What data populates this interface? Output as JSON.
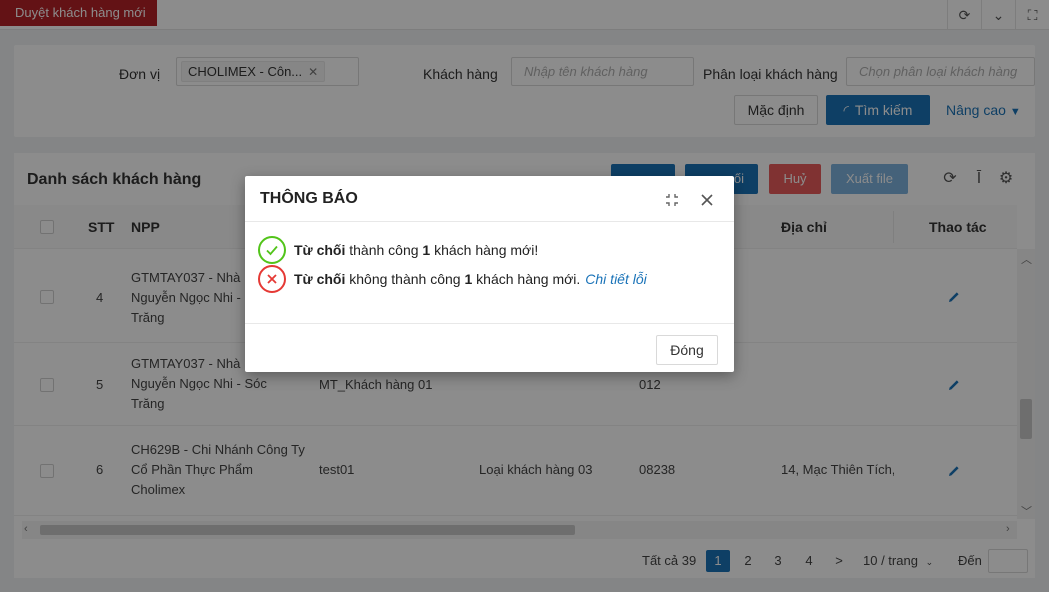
{
  "app": {
    "active_tab": "Duyệt khách hàng mới"
  },
  "filters": {
    "unit_label": "Đơn vị",
    "unit_tag": "CHOLIMEX - Côn...",
    "customer_label": "Khách hàng",
    "customer_placeholder": "Nhập tên khách hàng",
    "category_label": "Phân loại khách hàng",
    "category_placeholder": "Chọn phân loại khách hàng",
    "default_button": "Mặc định",
    "search_button": "Tìm kiếm",
    "advanced_button": "Nâng cao"
  },
  "list": {
    "title": "Danh sách khách hàng",
    "toolbar": {
      "reject_label": "...ối",
      "cancel_label": "Huỷ",
      "export_label": "Xuất file"
    },
    "columns": {
      "stt": "STT",
      "npp": "NPP",
      "address": "Địa chỉ",
      "actions": "Thao tác"
    },
    "rows": [
      {
        "stt": "4",
        "npp_lines": [
          "GTMTAY037 - Nhà",
          "Nguyễn Ngọc Nhi - Sóc",
          "Trăng"
        ],
        "name": "",
        "category": "",
        "code": "",
        "address": ""
      },
      {
        "stt": "5",
        "npp_lines": [
          "GTMTAY037 - Nhà",
          "Nguyễn Ngọc Nhi - Sóc",
          "Trăng"
        ],
        "name": "MT_Khách hàng 01",
        "category": "",
        "code": "012",
        "address": ""
      },
      {
        "stt": "6",
        "npp_lines": [
          "CH629B - Chi Nhánh Công Ty",
          "Cổ Phần Thực Phẩm",
          "Cholimex"
        ],
        "name": "test01",
        "category": "Loại khách hàng 03",
        "code": "08238",
        "address": "14, Mạc Thiên Tích,"
      }
    ]
  },
  "pagination": {
    "total": "Tất cả 39",
    "pages": [
      "1",
      "2",
      "3",
      "4"
    ],
    "active_page": "1",
    "next": ">",
    "page_size": "10 / trang",
    "goto_label": "Đến"
  },
  "modal": {
    "title": "THÔNG BÁO",
    "success": {
      "bold": "Từ chối",
      "text1": " thành công ",
      "count": "1",
      "text2": " khách hàng mới!"
    },
    "failure": {
      "bold": "Từ chối",
      "text1": " không thành công ",
      "count": "1",
      "text2": " khách hàng mới.",
      "link": "Chi tiết lỗi"
    },
    "close_button": "Đóng"
  },
  "colors": {
    "brand_red": "#b52227",
    "primary_blue": "#1a73b8",
    "success_green": "#52c41a",
    "error_red": "#e53935"
  }
}
